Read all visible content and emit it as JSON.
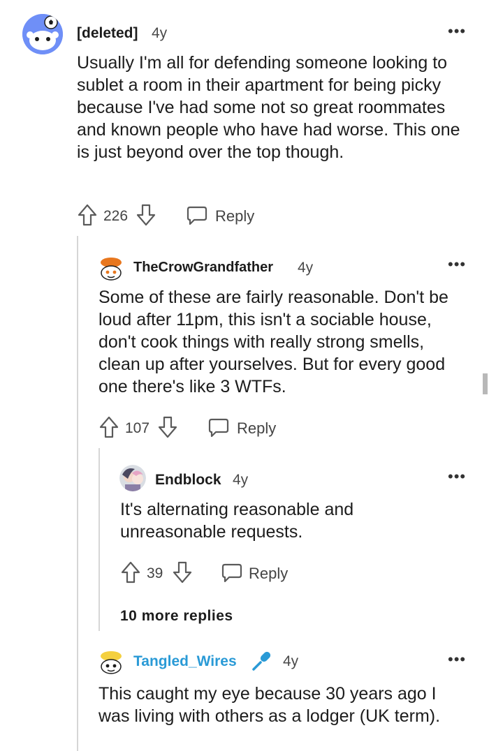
{
  "comments": [
    {
      "username": "[deleted]",
      "age": "4y",
      "text": "Usually I'm all for defending someone looking to sublet a room in their apartment for being picky because I've had some not so great roommates and known people who have had worse. This one is just beyond over the top though.",
      "score": "226",
      "reply_label": "Reply"
    },
    {
      "username": "TheCrowGrandfather",
      "age": "4y",
      "text": "Some of these are fairly reasonable. Don't be loud after 11pm, this isn't a sociable house, don't cook things with really strong smells, clean up after yourselves. But for every good one there's like 3 WTFs.",
      "score": "107",
      "reply_label": "Reply"
    },
    {
      "username": "Endblock",
      "age": "4y",
      "text": "It's alternating reasonable and unreasonable requests.",
      "score": "39",
      "reply_label": "Reply",
      "more_replies": "10 more replies"
    },
    {
      "username": "Tangled_Wires",
      "age": "4y",
      "text": "This caught my eye because 30 years ago I was living with others as a lodger (UK term).",
      "username_color": "#2a9ad6",
      "flair_icon": "microphone-icon"
    }
  ],
  "colors": {
    "text": "#1c1c1c",
    "muted": "#4a4a4a",
    "icon": "#5a5a5a",
    "thread_line": "#d6d6d6",
    "link_username": "#2a9ad6"
  }
}
